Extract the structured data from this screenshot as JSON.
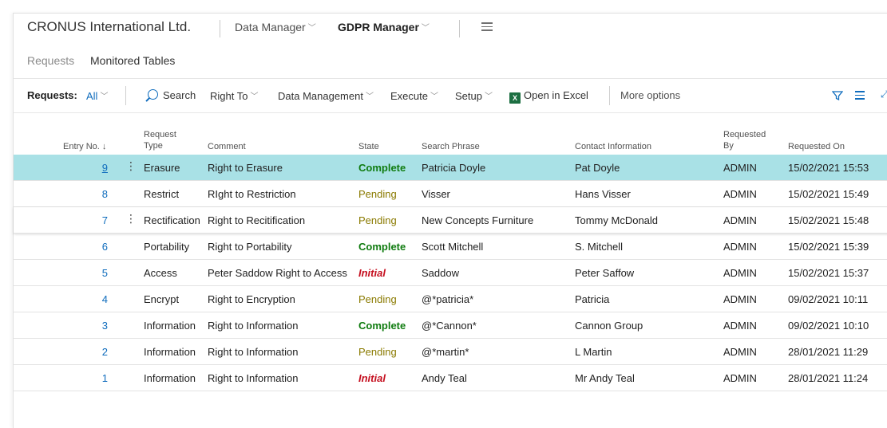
{
  "header": {
    "company": "CRONUS International Ltd.",
    "nav": [
      {
        "label": "Data Manager"
      },
      {
        "label": "GDPR Manager"
      }
    ]
  },
  "subtabs": {
    "requests": "Requests",
    "monitored": "Monitored Tables"
  },
  "actionbar": {
    "title": "Requests:",
    "filter": "All",
    "search": "Search",
    "right_to": "Right To",
    "data_management": "Data Management",
    "execute": "Execute",
    "setup": "Setup",
    "open_in_excel": "Open in Excel",
    "more_options": "More options"
  },
  "columns": {
    "entry_no": "Entry No.",
    "request_type_1": "Request",
    "request_type_2": "Type",
    "comment": "Comment",
    "state": "State",
    "search_phrase": "Search Phrase",
    "contact": "Contact Information",
    "requested_by_1": "Requested",
    "requested_by_2": "By",
    "requested_on": "Requested On"
  },
  "rows": [
    {
      "entry": "9",
      "type": "Erasure",
      "comment": "Right to Erasure",
      "state": "Complete",
      "phrase": "Patricia Doyle",
      "contact": "Pat Doyle",
      "by": "ADMIN",
      "on": "15/02/2021 15:53"
    },
    {
      "entry": "8",
      "type": "Restrict",
      "comment": "RIght to Restriction",
      "state": "Pending",
      "phrase": "Visser",
      "contact": "Hans Visser",
      "by": "ADMIN",
      "on": "15/02/2021 15:49"
    },
    {
      "entry": "7",
      "type": "Rectification",
      "comment": "Right to Recitification",
      "state": "Pending",
      "phrase": "New Concepts Furniture",
      "contact": "Tommy McDonald",
      "by": "ADMIN",
      "on": "15/02/2021 15:48"
    },
    {
      "entry": "6",
      "type": "Portability",
      "comment": "Right to Portability",
      "state": "Complete",
      "phrase": "Scott Mitchell",
      "contact": "S. Mitchell",
      "by": "ADMIN",
      "on": "15/02/2021 15:39"
    },
    {
      "entry": "5",
      "type": "Access",
      "comment": "Peter Saddow Right to Access",
      "state": "Initial",
      "phrase": "Saddow",
      "contact": "Peter Saffow",
      "by": "ADMIN",
      "on": "15/02/2021 15:37"
    },
    {
      "entry": "4",
      "type": "Encrypt",
      "comment": "Right to Encryption",
      "state": "Pending",
      "phrase": "@*patricia*",
      "contact": "Patricia",
      "by": "ADMIN",
      "on": "09/02/2021 10:11"
    },
    {
      "entry": "3",
      "type": "Information",
      "comment": "Right to Information",
      "state": "Complete",
      "phrase": "@*Cannon*",
      "contact": "Cannon Group",
      "by": "ADMIN",
      "on": "09/02/2021 10:10"
    },
    {
      "entry": "2",
      "type": "Information",
      "comment": "Right to Information",
      "state": "Pending",
      "phrase": "@*martin*",
      "contact": "L Martin",
      "by": "ADMIN",
      "on": "28/01/2021 11:29"
    },
    {
      "entry": "1",
      "type": "Information",
      "comment": "Right to Information",
      "state": "Initial",
      "phrase": "Andy Teal",
      "contact": "Mr Andy Teal",
      "by": "ADMIN",
      "on": "28/01/2021 11:24"
    }
  ],
  "colors": {
    "accent": "#0f6cbd",
    "selected_row": "#a9e1e6",
    "complete": "#107c10",
    "pending": "#8a7a00",
    "initial": "#c50f1f"
  }
}
